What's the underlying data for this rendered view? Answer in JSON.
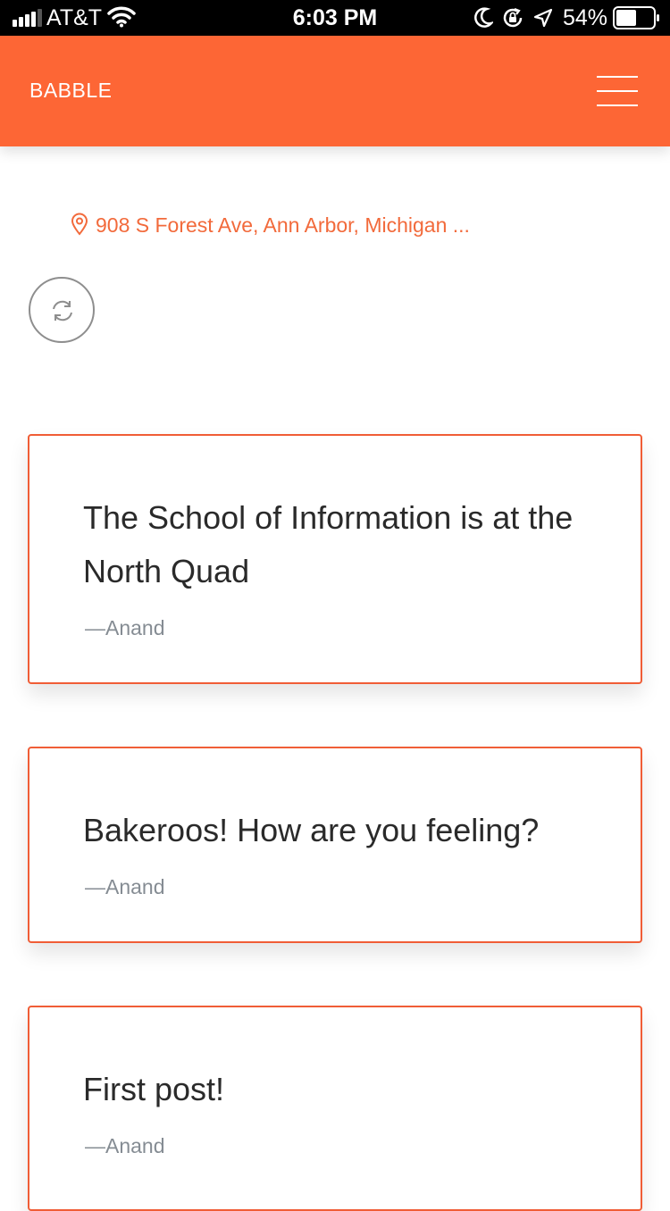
{
  "status_bar": {
    "carrier": "AT&T",
    "time": "6:03 PM",
    "battery": "54%",
    "battery_level": 0.54,
    "icons": [
      "signal-icon",
      "wifi-icon",
      "moon-icon",
      "rotation-lock-icon",
      "location-arrow-icon",
      "battery-icon"
    ]
  },
  "header": {
    "brand": "BABBLE",
    "menu_icon": "hamburger-menu-icon",
    "background": "#fd6635"
  },
  "location": {
    "icon": "map-pin-icon",
    "text": "908 S Forest Ave, Ann Arbor, Michigan ...",
    "color": "#f26a3b"
  },
  "refresh": {
    "icon": "refresh-icon"
  },
  "posts": [
    {
      "message": "The School of Information is at the North Quad",
      "author": "—Anand"
    },
    {
      "message": "Bakeroos! How are you feeling?",
      "author": "—Anand"
    },
    {
      "message": "First post!",
      "author": "—Anand"
    }
  ],
  "colors": {
    "accent": "#fd6635",
    "card_border": "#f05d36",
    "author_text": "#858c93"
  }
}
